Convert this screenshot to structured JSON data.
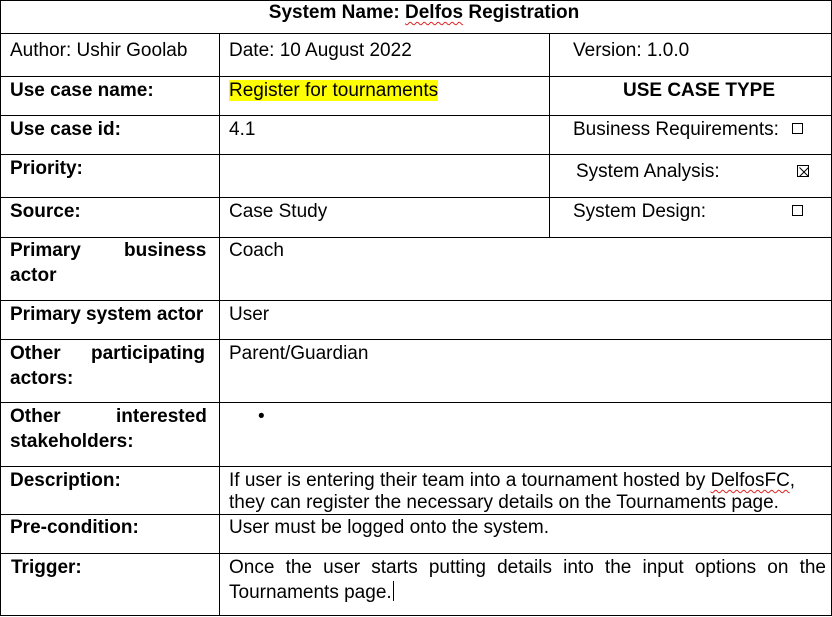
{
  "title": {
    "prefix": "System Name: ",
    "name_underlined": "Delfos",
    "suffix": " Registration"
  },
  "header_row": {
    "author": "Author: Ushir Goolab",
    "date": "Date: 10 August 2022",
    "version": "Version: 1.0.0"
  },
  "use_case_name": {
    "label": "Use case name:",
    "value": "Register for tournaments",
    "type_heading": "USE CASE TYPE"
  },
  "use_case_id": {
    "label": "Use case id:",
    "value": "4.1",
    "type_label": "Business Requirements:"
  },
  "priority": {
    "label": "Priority:",
    "value": "",
    "type_label": "System Analysis:"
  },
  "source": {
    "label": "Source:",
    "value": "Case Study",
    "type_label": "System Design:"
  },
  "primary_business_actor": {
    "label_word1": "Primary",
    "label_word2": "business",
    "label_line2": "actor",
    "value": "Coach"
  },
  "primary_system_actor": {
    "label": "Primary system actor",
    "value": "User"
  },
  "other_participating": {
    "label_word1": "Other",
    "label_word2": "participating",
    "label_line2": "actors:",
    "value": "Parent/Guardian"
  },
  "other_interested": {
    "label_word1": "Other",
    "label_word2": "interested",
    "label_line2": "stakeholders:",
    "bullet": "•"
  },
  "description": {
    "label": "Description:",
    "line1_before": "If user is entering their team into a tournament hosted by ",
    "line1_underlined": "DelfosFC",
    "line1_after": ",",
    "line2": "they can register the necessary details on the Tournaments page."
  },
  "precondition": {
    "label": "Pre-condition:",
    "value": "User must be logged onto the system."
  },
  "trigger": {
    "label": "Trigger:",
    "line1": "Once the user starts putting details into the input options on the",
    "line2": "Tournaments page."
  },
  "checkboxes": {
    "business_requirements": "unchecked",
    "system_analysis": "checked",
    "system_design": "unchecked"
  },
  "colors": {
    "highlight": "#ffff00",
    "spellcheck_underline": "#d22"
  }
}
